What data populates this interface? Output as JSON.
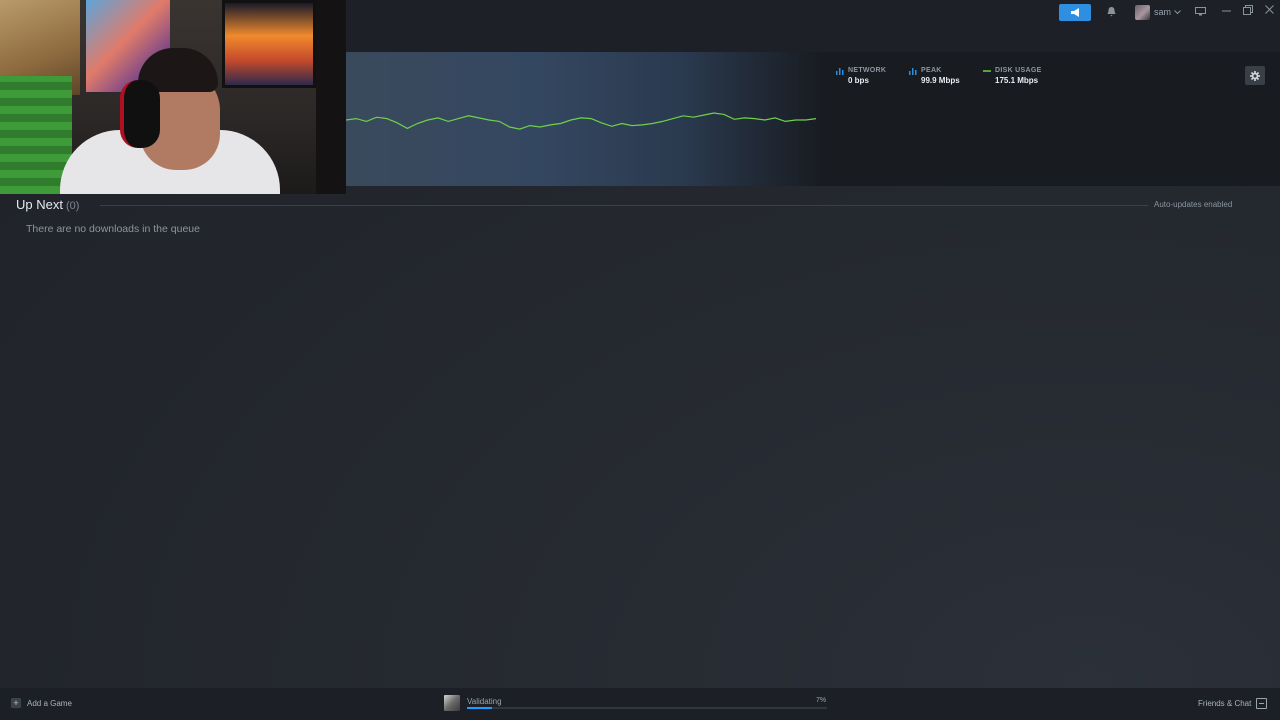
{
  "header": {
    "username": "sam",
    "icons": {
      "announcement": "megaphone-icon",
      "notifications": "bell-icon",
      "user_menu": "chevron-down-icon",
      "big_picture": "monitor-icon",
      "minimize": "minimize-icon",
      "restore": "restore-icon",
      "close": "close-icon"
    }
  },
  "download_stats": {
    "network": {
      "label": "NETWORK",
      "value": "0 bps"
    },
    "peak": {
      "label": "PEAK",
      "value": "99.9 Mbps"
    },
    "disk_usage": {
      "label": "DISK USAGE",
      "value": "175.1 Mbps"
    },
    "settings_icon": "gear-icon"
  },
  "up_next": {
    "title": "Up Next",
    "count": "(0)",
    "auto_updates": "Auto-updates enabled",
    "empty_message": "There are no downloads in the queue"
  },
  "bottom_bar": {
    "add_game": "Add a Game",
    "download_status": "Validating",
    "download_percent": "7%",
    "progress": 0.07,
    "friends_chat": "Friends & Chat"
  },
  "colors": {
    "accent": "#1a9fff",
    "graph_line": "#6fd14a",
    "announce_button": "#2e8ee0"
  },
  "chart_data": {
    "type": "line",
    "series": [
      {
        "values": [
          60,
          62,
          58,
          64,
          62,
          56,
          48,
          55,
          60,
          63,
          58,
          62,
          66,
          63,
          60,
          58,
          50,
          47,
          52,
          50,
          53,
          55,
          60,
          63,
          62,
          56,
          51,
          55,
          52,
          53,
          55,
          58,
          62,
          66,
          64,
          67,
          70,
          68,
          61,
          63,
          62,
          60,
          63,
          58,
          60,
          60,
          62
        ]
      }
    ]
  }
}
